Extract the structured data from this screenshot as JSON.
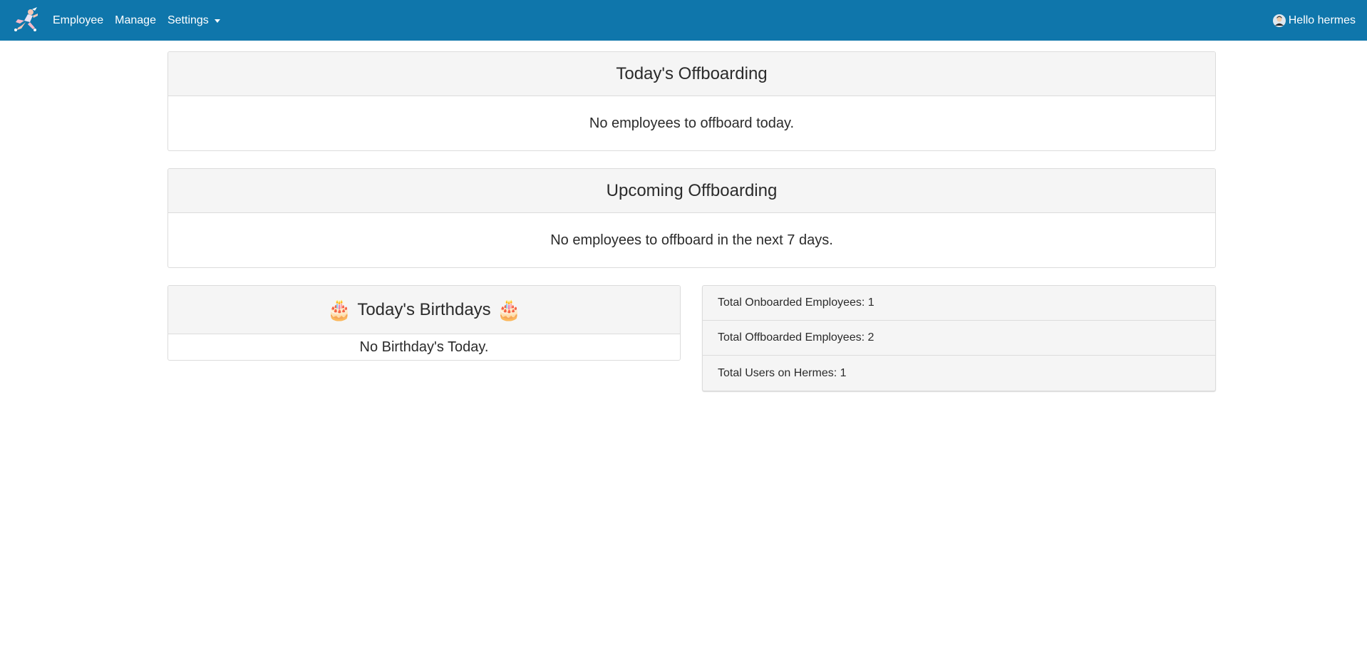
{
  "navbar": {
    "brand_icon": "hermes-logo-icon",
    "links": [
      "Employee",
      "Manage",
      "Settings"
    ],
    "user_greeting": "Hello hermes",
    "accent_color": "#0f76ab"
  },
  "today_offboarding": {
    "title": "Today's Offboarding",
    "message": "No employees to offboard today."
  },
  "upcoming_offboarding": {
    "title": "Upcoming Offboarding",
    "message": "No employees to offboard in the next 7 days."
  },
  "birthdays": {
    "cake_left": "🎂",
    "title": "Today's Birthdays",
    "cake_right": "🎂",
    "message": "No Birthday's Today."
  },
  "stats": [
    "Total Onboarded Employees: 1",
    "Total Offboarded Employees: 2",
    "Total Users on Hermes: 1"
  ]
}
